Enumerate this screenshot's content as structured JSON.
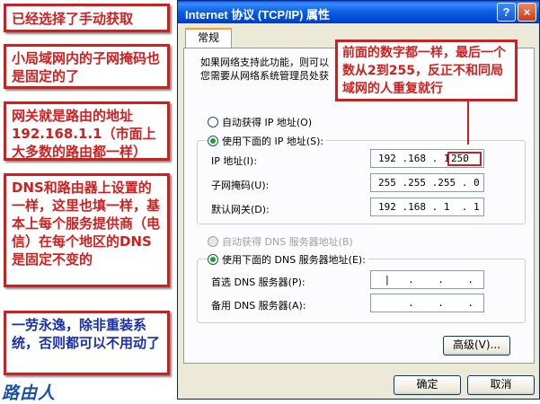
{
  "notes": [
    "已经选择了手动获取",
    "小局域网内的子网掩码也是固定的了",
    "网关就是路由的地址192.168.1.1（市面上大多数的路由都一样）",
    "DNS和路由器上设置的一样，这里也填一样，基本上每个服务提供商（电信）在每个地区的DNS是固定不变的",
    "一劳永逸，除非重装系统，否则都可以不用动了"
  ],
  "logo_text": "路由人",
  "window": {
    "title": "Internet 协议 (TCP/IP) 属性",
    "help_label": "?",
    "close_label": "×",
    "tab_label": "常规",
    "intro_line1": "如果网络支持此功能，则可以",
    "intro_line2": "您需要从网络系统管理员处获",
    "auto_ip_label": "自动获得 IP 地址(O)",
    "manual_ip_label": "使用下面的 IP 地址(S):",
    "ip_label": "IP 地址(I):",
    "ip_value": "192 .168 . 1  .",
    "ip_last": "250",
    "mask_label": "子网掩码(U):",
    "mask_value": "255 .255 .255 . 0",
    "gateway_label": "默认网关(D):",
    "gateway_value": "192 .168 . 1  . 1",
    "auto_dns_label": "自动获得 DNS 服务器地址(B)",
    "manual_dns_label": "使用下面的 DNS 服务器地址(E):",
    "dns1_label": "首选 DNS 服务器(P):",
    "dns1_value": " |   .    .    .",
    "dns2_label": "备用 DNS 服务器(A):",
    "dns2_value": "     .    .    .",
    "advanced_label": "高级(V)...",
    "ok_label": "确定",
    "cancel_label": "取消"
  },
  "callout": "前面的数字都一样，最后一个数从2到255，反正不和同局域网的人重复就行",
  "colors": {
    "annotation_red": "#d11e1e",
    "annotation_blue": "#1a2fb0",
    "xp_blue": "#0058ee"
  }
}
